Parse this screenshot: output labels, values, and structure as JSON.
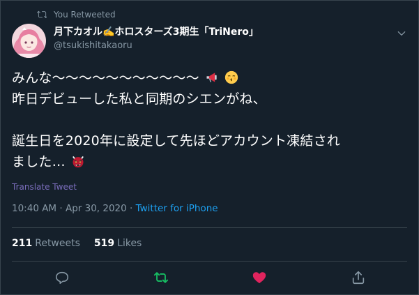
{
  "retweet_banner": {
    "label": "You Retweeted",
    "icon": "retweet-icon"
  },
  "author": {
    "display_name": "月下カオル✍️ホロスターズ3期生「TriNero」",
    "handle": "@tsukishitakaoru",
    "avatar_icon": "avatar"
  },
  "tweet": {
    "lines": [
      "みんな〜〜〜〜〜〜〜〜〜〜〜",
      "昨日デビューした私と同期のシエンがね、",
      "",
      "誕生日を2020年に設定して先ほどアカウント凍結され",
      "ました…"
    ],
    "emojis": [
      "megaphone",
      "kissing-face",
      "ogre-face"
    ]
  },
  "translate_label": "Translate Tweet",
  "meta": {
    "time": "10:40 AM",
    "separator": " · ",
    "date": "Apr 30, 2020",
    "source": "Twitter for iPhone"
  },
  "stats": {
    "retweets_count": "211",
    "retweets_label": "Retweets",
    "likes_count": "519",
    "likes_label": "Likes"
  },
  "actions": {
    "reply_icon": "reply-icon",
    "retweet_icon": "retweet-icon",
    "like_icon": "heart-icon",
    "share_icon": "share-icon"
  },
  "colors": {
    "background": "#15202b",
    "border": "#38444d",
    "muted": "#8899a6",
    "accent": "#1da1f2",
    "retweet_active": "#17bf63",
    "like_active": "#e0245e"
  }
}
